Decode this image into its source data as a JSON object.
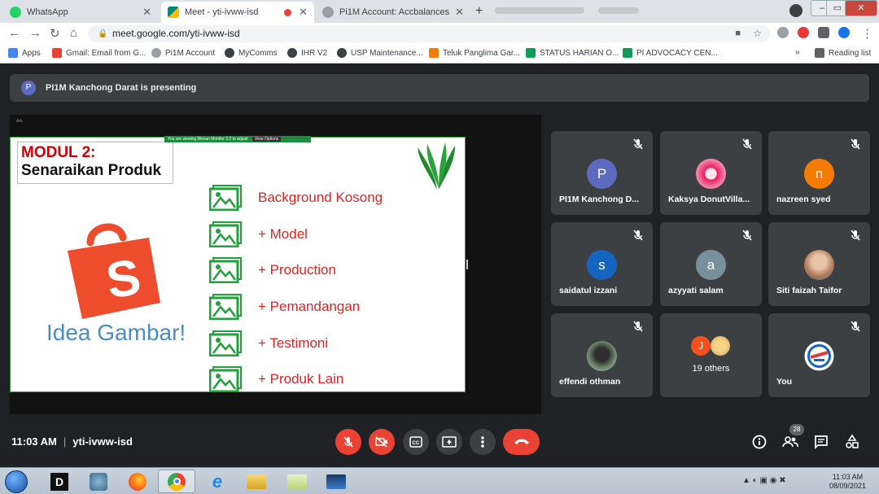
{
  "browser": {
    "tabs": [
      {
        "label": "WhatsApp",
        "color": "#25d366"
      },
      {
        "label": "Meet - yti-ivww-isd",
        "color": "#00897b"
      },
      {
        "label": "Pi1M Account: Accbalances",
        "color": "#5f6368"
      }
    ],
    "url": "meet.google.com/yti-ivww-isd",
    "bookmarks": [
      {
        "label": "Apps",
        "color": "#4285f4"
      },
      {
        "label": "Gmail: Email from G...",
        "color": "#ea4335"
      },
      {
        "label": "Pi1M Account",
        "color": "#5f6368"
      },
      {
        "label": "MyComms",
        "color": "#3c4043"
      },
      {
        "label": "IHR V2",
        "color": "#3c4043"
      },
      {
        "label": "USP Maintenance...",
        "color": "#3c4043"
      },
      {
        "label": "Teluk Panglima Gar...",
        "color": "#f57c00"
      },
      {
        "label": "STATUS HARIAN O...",
        "color": "#0f9d58"
      },
      {
        "label": "PI ADVOCACY CEN...",
        "color": "#0f9d58"
      }
    ],
    "reading_list": "Reading list",
    "more_bookmarks": "»"
  },
  "meet": {
    "presenting_avatar": "P",
    "presenting_text": "PI1M Kanchong Darat is presenting",
    "time": "11:03 AM",
    "meeting_code": "yti-ivww-isd",
    "participant_count": "28",
    "slide": {
      "mini_label": "Ark",
      "view_bar": "You are viewing Monan Monitor 3.2 to adjust",
      "view_options": "View Options",
      "title_line1": "MODUL 2:",
      "title_line2": "Senaraikan Produk",
      "idea_text": "Idea Gambar!",
      "items": [
        "Background Kosong",
        "+ Model",
        "+ Production",
        "+ Pemandangan",
        "+ Testimoni",
        "+ Produk Lain"
      ]
    },
    "participants": [
      {
        "name": "PI1M Kanchong D...",
        "initial": "P",
        "color": "#5c6bc0"
      },
      {
        "name": "Kaksya DonutVilla...",
        "initial": "",
        "color": "#e91e63"
      },
      {
        "name": "nazreen syed",
        "initial": "n",
        "color": "#f57c00"
      },
      {
        "name": "saidatul izzani",
        "initial": "s",
        "color": "#1565c0"
      },
      {
        "name": "azyyati salam",
        "initial": "a",
        "color": "#78909c"
      },
      {
        "name": "Siti faizah Taifor",
        "initial": "",
        "color": "#c8a27a"
      },
      {
        "name": "effendi othman",
        "initial": "",
        "color": "#6d8a6a"
      },
      {
        "name": "19 others",
        "initial": "J",
        "color": "#f4511e"
      },
      {
        "name": "You",
        "initial": "",
        "color": "#ffffff"
      }
    ]
  },
  "taskbar": {
    "time": "11:03 AM",
    "date": "08/09/2021"
  }
}
